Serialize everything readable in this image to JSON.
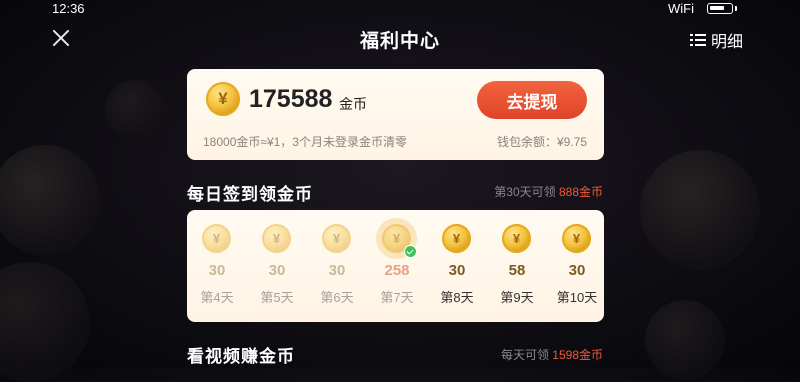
{
  "status_bar": {
    "time": "12:36",
    "wifi": "WiFi"
  },
  "nav": {
    "title": "福利中心",
    "detail_label": "明细"
  },
  "balance": {
    "coin_symbol": "¥",
    "amount": "175588",
    "unit": "金币",
    "withdraw_label": "去提现",
    "rate_note": "18000金币≈¥1，3个月未登录金币清零",
    "wallet_note": "钱包余额：¥9.75"
  },
  "signin": {
    "title": "每日签到领金币",
    "side_prefix": "第30天可领 ",
    "side_highlight": "888金币",
    "days": [
      {
        "amount": "30",
        "label": "第4天"
      },
      {
        "amount": "30",
        "label": "第5天"
      },
      {
        "amount": "30",
        "label": "第6天"
      },
      {
        "amount": "258",
        "label": "第7天"
      },
      {
        "amount": "30",
        "label": "第8天"
      },
      {
        "amount": "58",
        "label": "第9天"
      },
      {
        "amount": "30",
        "label": "第10天"
      }
    ]
  },
  "video": {
    "title": "看视频赚金币",
    "side_prefix": "每天可领 ",
    "side_highlight": "1598金币"
  },
  "colors": {
    "accent": "#e0442a",
    "coin_gold": "#f3c23c",
    "check_green": "#3fc15c"
  }
}
